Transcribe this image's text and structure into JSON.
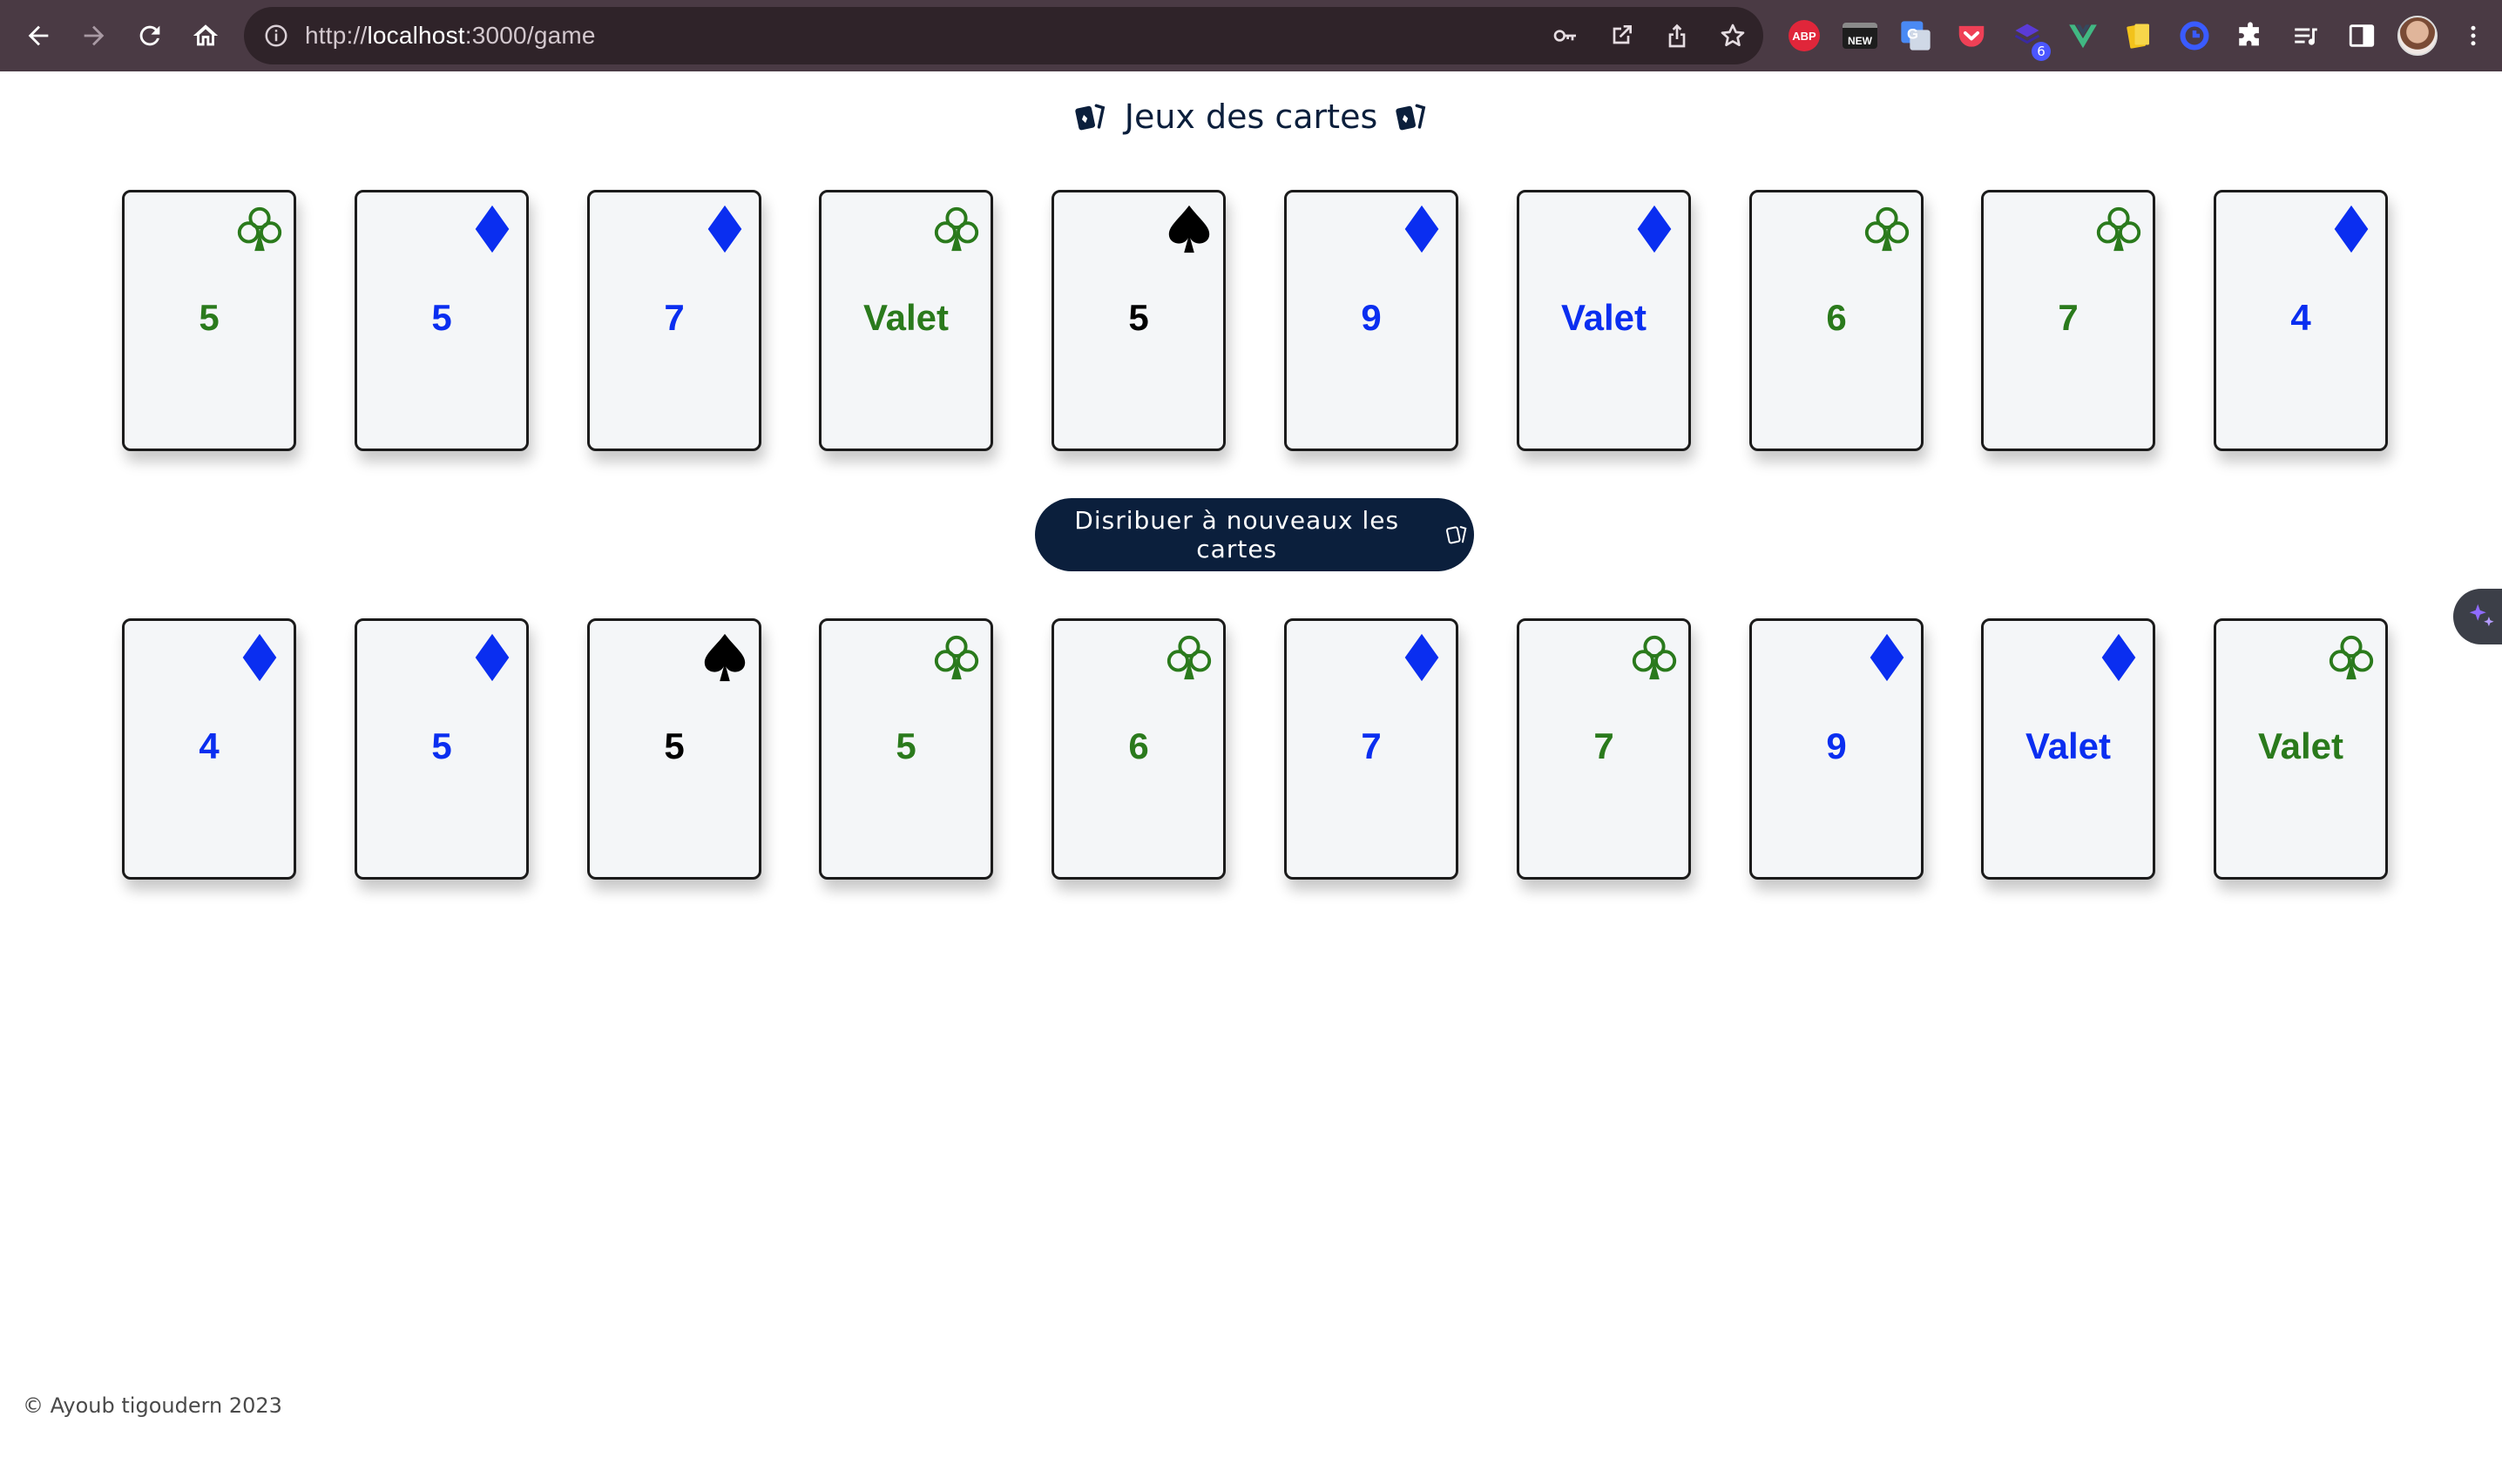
{
  "browser": {
    "url_prefix": "http://",
    "url_host": "localhost",
    "url_rest": ":3000/game",
    "extensions": [
      {
        "name": "abp-icon",
        "label": "ABP"
      },
      {
        "name": "new-tab-extension-icon",
        "label": "NEW"
      },
      {
        "name": "google-translate-icon",
        "label": "G"
      },
      {
        "name": "pocket-icon",
        "label": ""
      },
      {
        "name": "stack-extension-icon",
        "label": "",
        "badge": "6"
      },
      {
        "name": "vue-devtools-icon",
        "label": "V"
      },
      {
        "name": "notes-extension-icon",
        "label": ""
      },
      {
        "name": "blue-circle-extension-icon",
        "label": ""
      }
    ]
  },
  "page": {
    "title": "Jeux des cartes",
    "deal_button_label": "Disribuer à nouveaux les cartes",
    "footer": "© Ayoub tigoudern 2023"
  },
  "colors": {
    "clubs": "#2a7a1c",
    "diamonds": "#0a2ef0",
    "spades": "#000000",
    "navy": "#0b1f3c"
  },
  "hands": {
    "top": [
      {
        "rank": "5",
        "suit": "clubs"
      },
      {
        "rank": "5",
        "suit": "diamonds"
      },
      {
        "rank": "7",
        "suit": "diamonds"
      },
      {
        "rank": "Valet",
        "suit": "clubs"
      },
      {
        "rank": "5",
        "suit": "spades"
      },
      {
        "rank": "9",
        "suit": "diamonds"
      },
      {
        "rank": "Valet",
        "suit": "diamonds"
      },
      {
        "rank": "6",
        "suit": "clubs"
      },
      {
        "rank": "7",
        "suit": "clubs"
      },
      {
        "rank": "4",
        "suit": "diamonds"
      }
    ],
    "bottom": [
      {
        "rank": "4",
        "suit": "diamonds"
      },
      {
        "rank": "5",
        "suit": "diamonds"
      },
      {
        "rank": "5",
        "suit": "spades"
      },
      {
        "rank": "5",
        "suit": "clubs"
      },
      {
        "rank": "6",
        "suit": "clubs"
      },
      {
        "rank": "7",
        "suit": "diamonds"
      },
      {
        "rank": "7",
        "suit": "clubs"
      },
      {
        "rank": "9",
        "suit": "diamonds"
      },
      {
        "rank": "Valet",
        "suit": "diamonds"
      },
      {
        "rank": "Valet",
        "suit": "clubs"
      }
    ]
  }
}
